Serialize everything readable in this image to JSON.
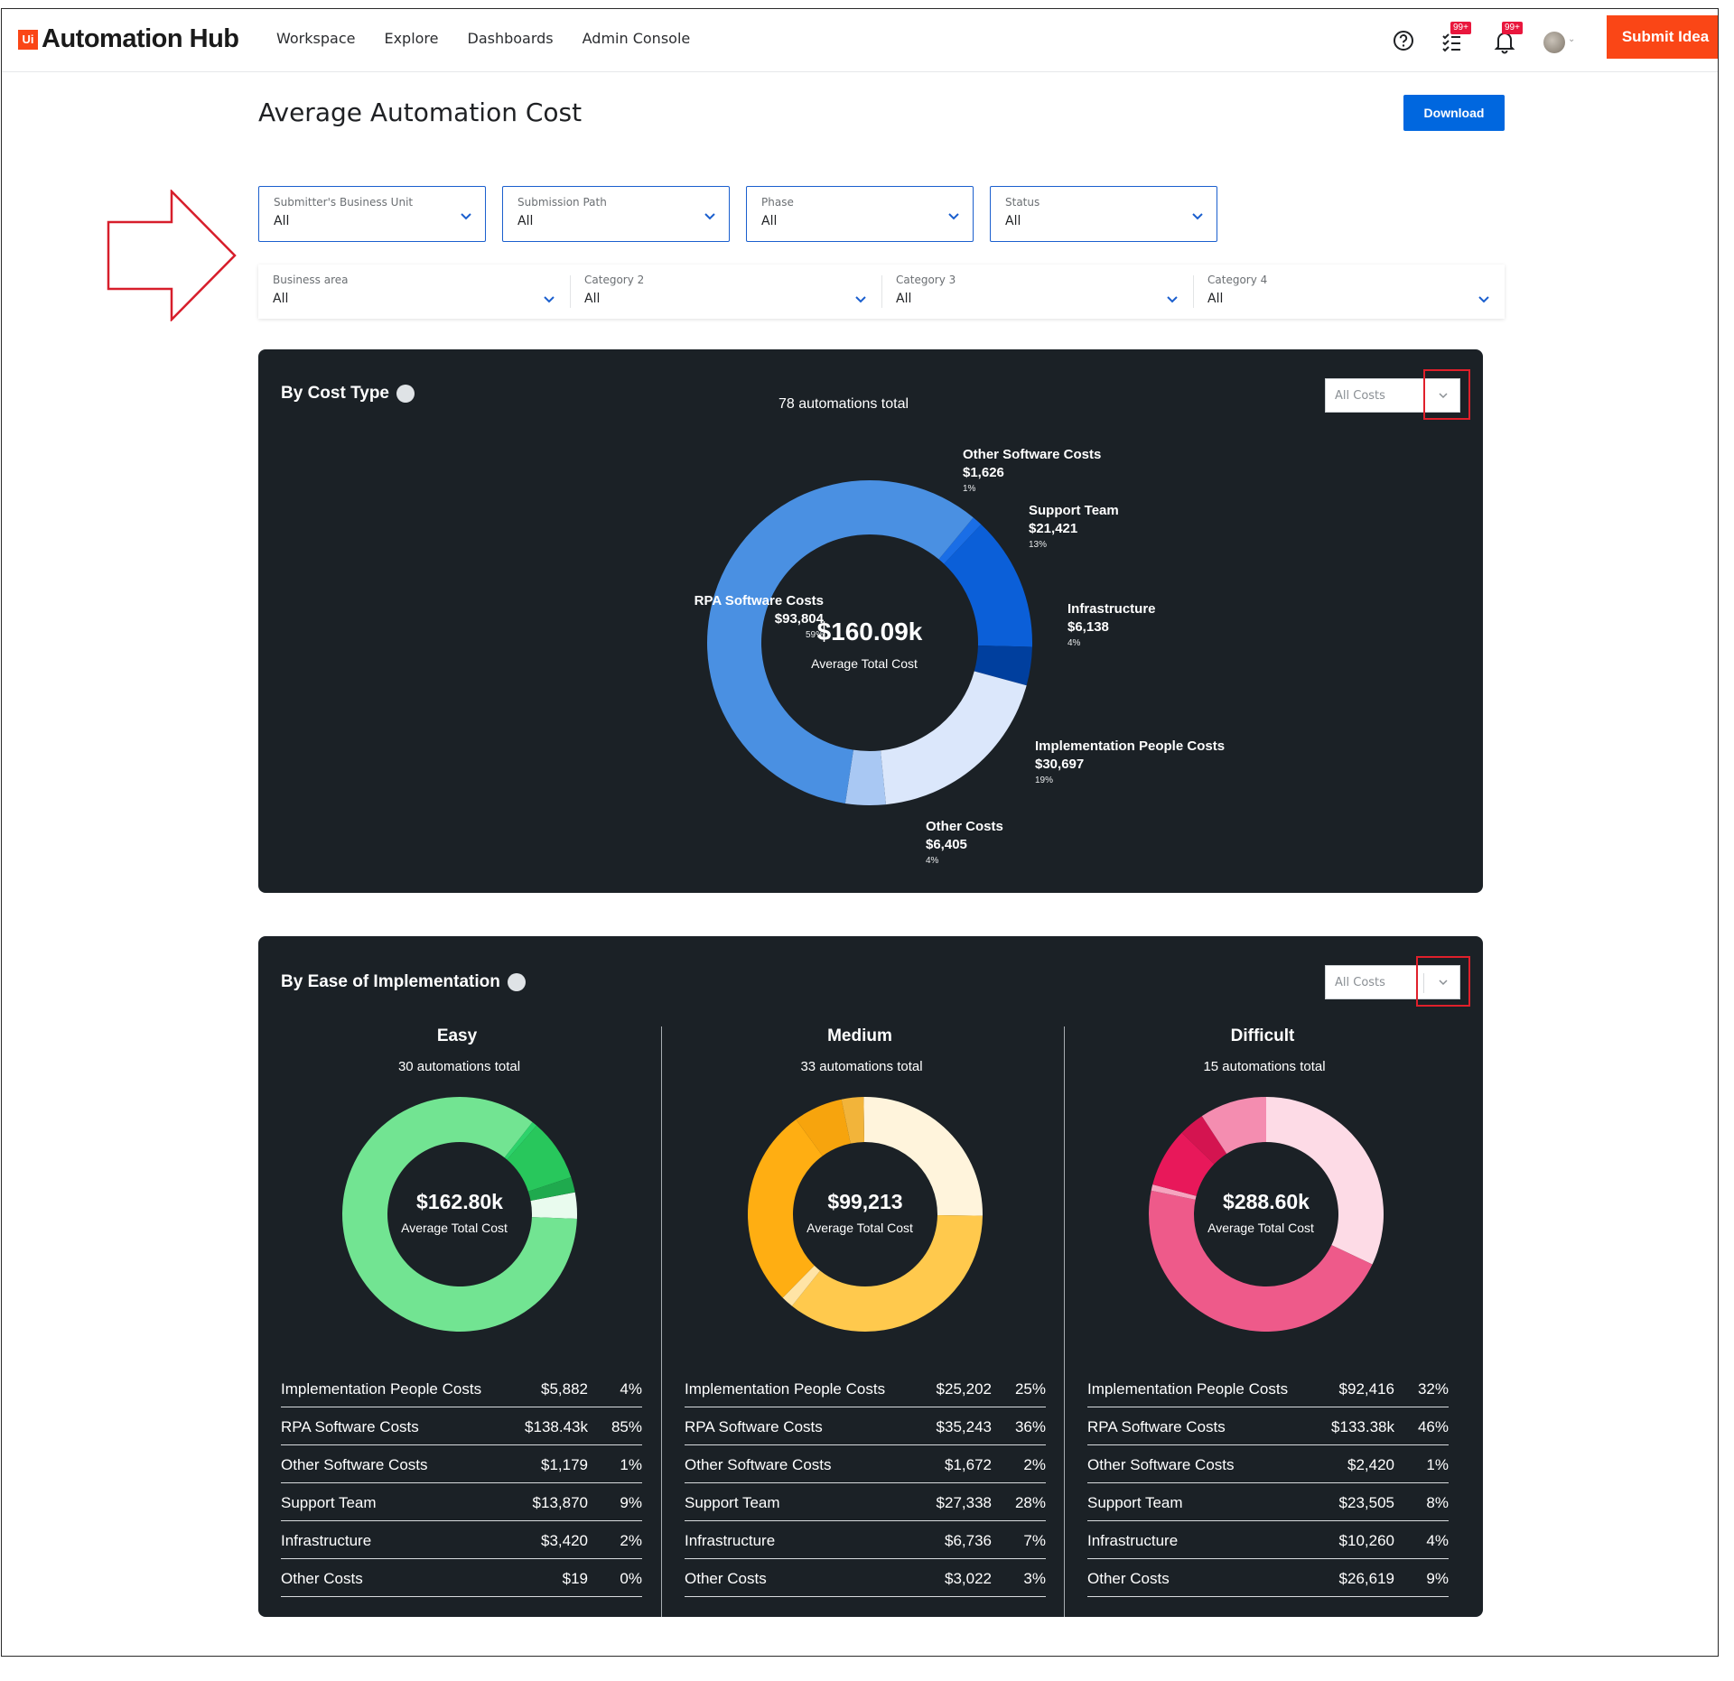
{
  "header": {
    "logo_mark": "Ui",
    "app_name": "Automation Hub",
    "nav": [
      "Workspace",
      "Explore",
      "Dashboards",
      "Admin Console"
    ],
    "tasks_badge": "99+",
    "notif_badge": "99+",
    "submit_label": "Submit Idea",
    "icons": [
      "help-circle-icon",
      "task-list-icon",
      "bell-icon",
      "avatar",
      "chevron-down-icon"
    ]
  },
  "page": {
    "title": "Average Automation Cost",
    "download_label": "Download"
  },
  "filters": {
    "row1": [
      {
        "label": "Submitter's Business Unit",
        "value": "All"
      },
      {
        "label": "Submission Path",
        "value": "All"
      },
      {
        "label": "Phase",
        "value": "All"
      },
      {
        "label": "Status",
        "value": "All"
      }
    ],
    "row2": [
      {
        "label": "Business area",
        "value": "All"
      },
      {
        "label": "Category 2",
        "value": "All"
      },
      {
        "label": "Category 3",
        "value": "All"
      },
      {
        "label": "Category 4",
        "value": "All"
      }
    ]
  },
  "colors": {
    "accent_orange": "#fa4616",
    "primary_blue": "#0067df",
    "panel_bg": "#1b2126",
    "annotation_red": "#e0202b"
  },
  "cost_panel": {
    "title": "By Cost Type",
    "select_value": "All Costs",
    "total_caption": "78 automations total",
    "center_value": "$160.09k",
    "center_caption": "Average Total Cost"
  },
  "ease_panel": {
    "title": "By Ease of Implementation",
    "select_value": "All Costs"
  },
  "chart_data": [
    {
      "type": "pie",
      "title": "By Cost Type",
      "categories": [
        "Other Software Costs",
        "Support Team",
        "Infrastructure",
        "Implementation People Costs",
        "Other Costs",
        "RPA Software Costs"
      ],
      "values": [
        1626,
        21421,
        6138,
        30697,
        6405,
        93804
      ],
      "value_labels": [
        "$1,626",
        "$21,421",
        "$6,138",
        "$30,697",
        "$6,405",
        "$93,804"
      ],
      "percents": [
        "1%",
        "13%",
        "4%",
        "19%",
        "4%",
        "59%"
      ],
      "colors": [
        "#1a6ee6",
        "#0b5fd8",
        "#003f9e",
        "#dbe7fb",
        "#a9c8f3",
        "#4a90e2"
      ]
    },
    {
      "type": "pie",
      "title": "Easy",
      "total_caption": "30 automations total",
      "center_value": "$162.80k",
      "center_caption": "Average Total Cost",
      "categories": [
        "Implementation People Costs",
        "RPA Software Costs",
        "Other Software Costs",
        "Support Team",
        "Infrastructure",
        "Other Costs"
      ],
      "value_labels": [
        "$5,882",
        "$138.43k",
        "$1,179",
        "$13,870",
        "$3,420",
        "$19"
      ],
      "values": [
        5882,
        138430,
        1179,
        13870,
        3420,
        19
      ],
      "percents": [
        "4%",
        "85%",
        "1%",
        "9%",
        "2%",
        "0%"
      ],
      "colors": [
        "#e9fbee",
        "#72e492",
        "#2dd36b",
        "#28c75c",
        "#1faa4e",
        "#178f40"
      ]
    },
    {
      "type": "pie",
      "title": "Medium",
      "total_caption": "33 automations total",
      "center_value": "$99,213",
      "center_caption": "Average Total Cost",
      "categories": [
        "Implementation People Costs",
        "RPA Software Costs",
        "Other Software Costs",
        "Support Team",
        "Infrastructure",
        "Other Costs"
      ],
      "value_labels": [
        "$25,202",
        "$35,243",
        "$1,672",
        "$27,338",
        "$6,736",
        "$3,022"
      ],
      "values": [
        25202,
        35243,
        1672,
        27338,
        6736,
        3022
      ],
      "percents": [
        "25%",
        "36%",
        "2%",
        "28%",
        "7%",
        "3%"
      ],
      "colors": [
        "#fff4dc",
        "#ffc94d",
        "#ffe4a6",
        "#ffae12",
        "#f7a40d",
        "#f2b43a"
      ]
    },
    {
      "type": "pie",
      "title": "Difficult",
      "total_caption": "15 automations total",
      "center_value": "$288.60k",
      "center_caption": "Average Total Cost",
      "categories": [
        "Implementation People Costs",
        "RPA Software Costs",
        "Other Software Costs",
        "Support Team",
        "Infrastructure",
        "Other Costs"
      ],
      "value_labels": [
        "$92,416",
        "$133.38k",
        "$2,420",
        "$23,505",
        "$10,260",
        "$26,619"
      ],
      "values": [
        92416,
        133380,
        2420,
        23505,
        10260,
        26619
      ],
      "percents": [
        "32%",
        "46%",
        "1%",
        "8%",
        "4%",
        "9%"
      ],
      "colors": [
        "#fddbe6",
        "#ee5a8a",
        "#f6a4bf",
        "#e8185a",
        "#d41450",
        "#f48db0"
      ]
    }
  ]
}
